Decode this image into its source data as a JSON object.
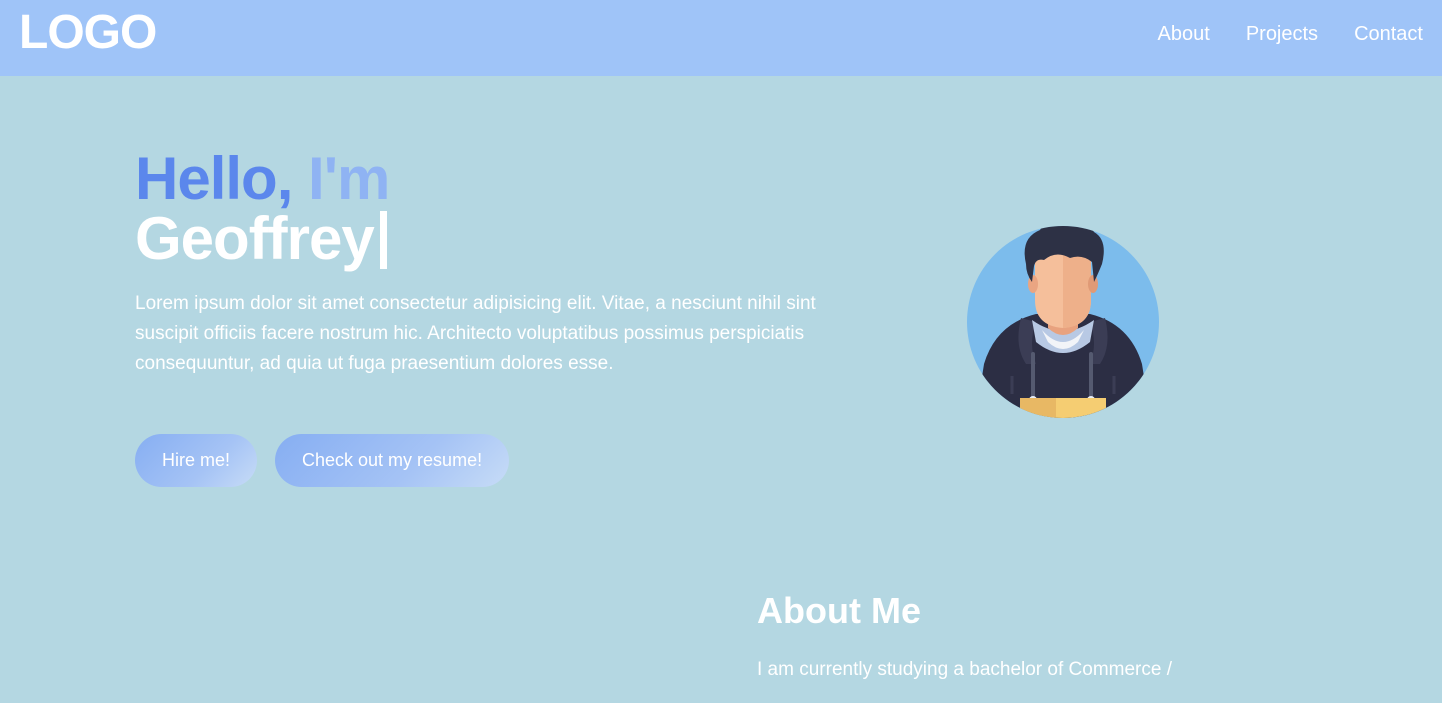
{
  "nav": {
    "logo": "LOGO",
    "links": [
      "About",
      "Projects",
      "Contact"
    ]
  },
  "hero": {
    "greeting_hello": "Hello,",
    "greeting_im": "I'm",
    "name": "Geoffrey",
    "intro": "Lorem ipsum dolor sit amet consectetur adipisicing elit. Vitae, a nesciunt nihil sint suscipit officiis facere nostrum hic. Architecto voluptatibus possimus perspiciatis consequuntur, ad quia ut fuga praesentium dolores esse.",
    "buttons": {
      "hire": "Hire me!",
      "resume": "Check out my resume!"
    }
  },
  "about": {
    "title": "About Me",
    "text": "I am currently studying a bachelor of Commerce /"
  },
  "colors": {
    "page_bg": "#b4d7e2",
    "nav_bg": "#9fc4f8",
    "accent_blue": "#5b87ec",
    "accent_light": "#8fb3f3",
    "avatar_circle": "#7cbcec"
  },
  "icons": {
    "avatar": "person-avatar-icon"
  }
}
